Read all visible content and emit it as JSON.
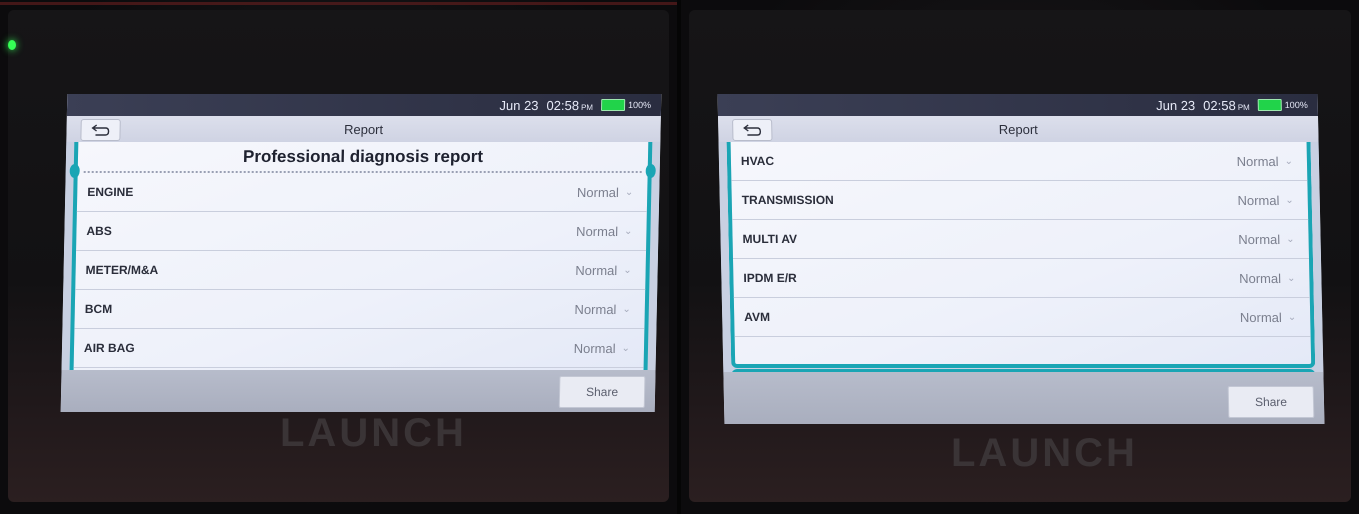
{
  "status": {
    "date": "Jun 23",
    "time": "02:58",
    "ampm": "PM",
    "battery": "100%"
  },
  "appbar": {
    "title": "Report"
  },
  "report": {
    "title": "Professional diagnosis report"
  },
  "left_rows": [
    {
      "name": "ENGINE",
      "status": "Normal"
    },
    {
      "name": "ABS",
      "status": "Normal"
    },
    {
      "name": "METER/M&A",
      "status": "Normal"
    },
    {
      "name": "BCM",
      "status": "Normal"
    },
    {
      "name": "AIR BAG",
      "status": "Normal"
    }
  ],
  "right_rows": [
    {
      "name": "HVAC",
      "status": "Normal"
    },
    {
      "name": "TRANSMISSION",
      "status": "Normal"
    },
    {
      "name": "MULTI AV",
      "status": "Normal"
    },
    {
      "name": "IPDM E/R",
      "status": "Normal"
    },
    {
      "name": "AVM",
      "status": "Normal"
    }
  ],
  "actions": {
    "share": "Share"
  },
  "device": {
    "brand": "LAUNCH"
  },
  "colors": {
    "accent": "#1aa5b4",
    "battery": "#21d34a",
    "led": "#35ff55"
  },
  "icons": {
    "back": "back-arrow-icon",
    "chevron": "chevron-down-icon"
  }
}
